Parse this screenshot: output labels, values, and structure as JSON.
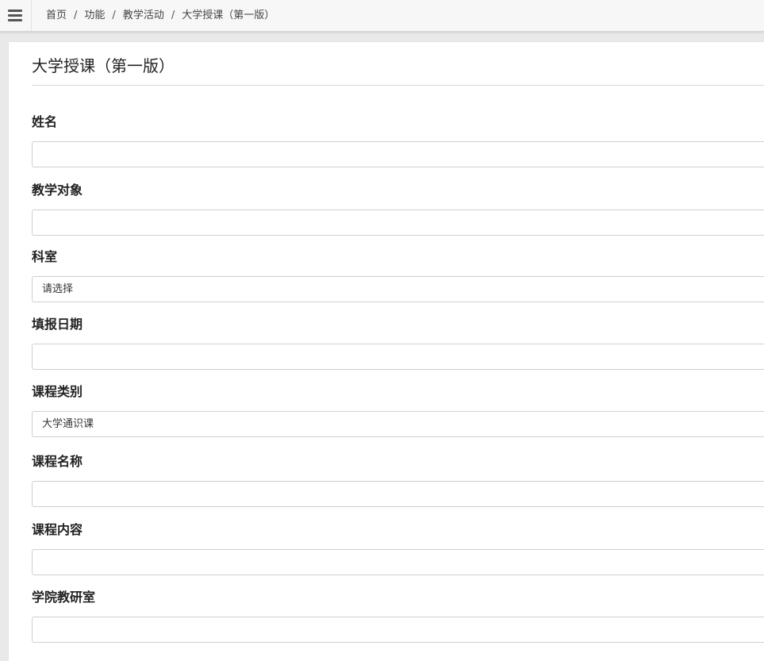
{
  "topbar": {
    "menu_icon": "hamburger-menu-icon",
    "breadcrumb": [
      "首页",
      "功能",
      "教学活动",
      "大学授课（第一版）"
    ],
    "separator": "/"
  },
  "page": {
    "title": "大学授课（第一版）"
  },
  "form": {
    "fields": [
      {
        "label": "姓名",
        "type": "text",
        "value": ""
      },
      {
        "label": "教学对象",
        "type": "text",
        "value": ""
      },
      {
        "label": "科室",
        "type": "select",
        "value": "请选择"
      },
      {
        "label": "填报日期",
        "type": "text",
        "value": ""
      },
      {
        "label": "课程类别",
        "type": "select",
        "value": "大学通识课"
      },
      {
        "label": "课程名称",
        "type": "text",
        "value": ""
      },
      {
        "label": "课程内容",
        "type": "text",
        "value": ""
      },
      {
        "label": "学院教研室",
        "type": "text",
        "value": ""
      }
    ]
  }
}
